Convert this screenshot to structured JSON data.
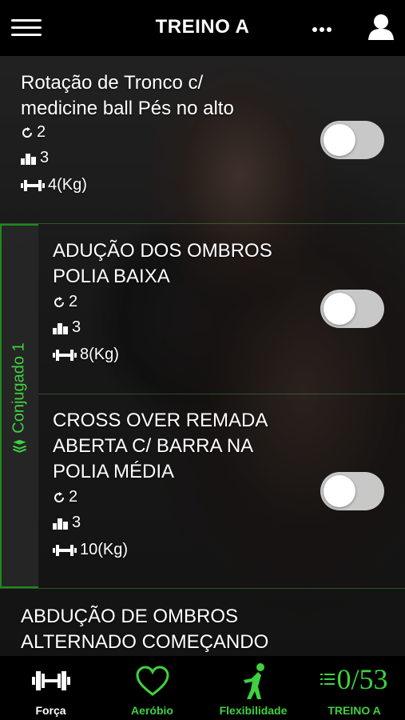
{
  "header": {
    "title": "TREINO A",
    "menu_icon": "hamburger-icon",
    "more_icon": "more-dots-icon",
    "profile_icon": "user-icon"
  },
  "exercises": [
    {
      "name": "Rotação de Tronco c/\nmedicine ball Pés no alto",
      "series": "2",
      "sets": "3",
      "weight": "4(Kg)",
      "done": false
    },
    {
      "name": "ADUÇÃO DOS OMBROS\nPOLIA BAIXA",
      "series": "2",
      "sets": "3",
      "weight": "8(Kg)",
      "done": false
    },
    {
      "name": "CROSS OVER REMADA\nABERTA C/ BARRA NA\nPOLIA MÉDIA",
      "series": "2",
      "sets": "3",
      "weight": "10(Kg)",
      "done": false
    },
    {
      "name": "ABDUÇÃO DE OMBROS\nALTERNADO COMEÇANDO"
    }
  ],
  "group": {
    "label": "Conjugado 1"
  },
  "bottom_nav": {
    "forca": "Força",
    "aerobio": "Aeróbio",
    "flexibilidade": "Flexibilidade",
    "treino": "TREINO A",
    "counter": "0/53"
  },
  "colors": {
    "accent": "#3fd13f",
    "background": "#000000"
  }
}
